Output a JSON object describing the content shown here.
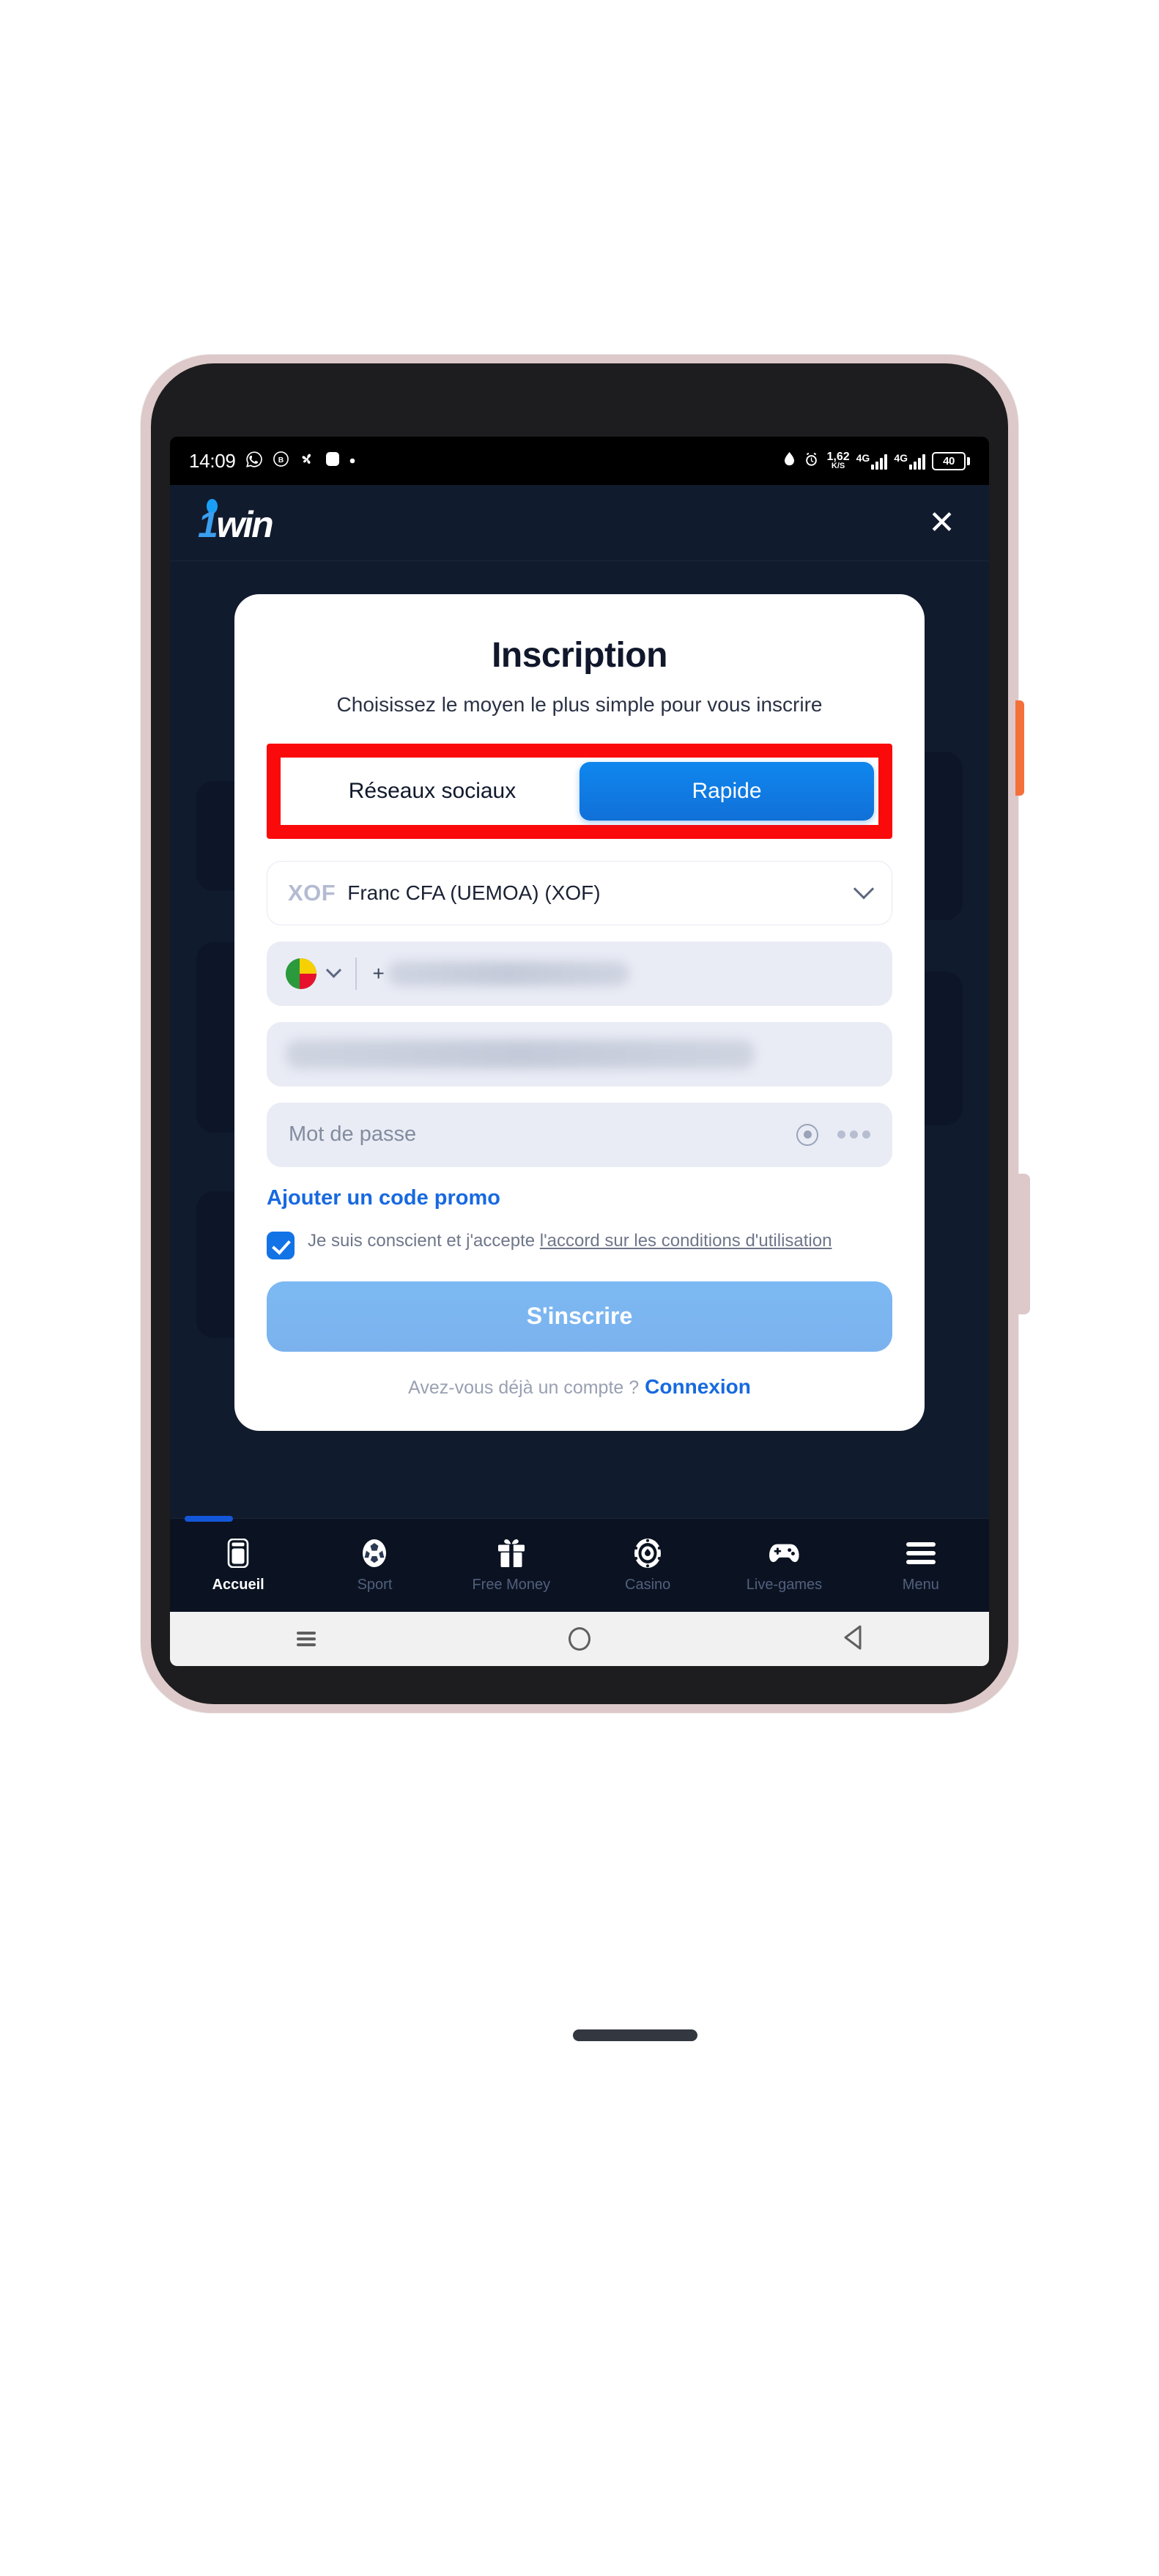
{
  "status_bar": {
    "time": "14:09",
    "left_icons": [
      "whatsapp-icon",
      "b-circle-icon",
      "fan-icon",
      "rounded-square-icon",
      "dot-icon"
    ],
    "network_speed_value": "1,62",
    "network_speed_unit": "K/S",
    "sim1_network": "4G",
    "sim2_network": "4G",
    "battery_level": "40",
    "right_icons": [
      "water-drop-icon",
      "alarm-icon"
    ]
  },
  "app_header": {
    "brand_one": "1",
    "brand_win": "win",
    "close_label": "✕"
  },
  "modal": {
    "title": "Inscription",
    "subtitle": "Choisissez le moyen le plus simple pour vous inscrire",
    "tabs": [
      {
        "label": "Réseaux sociaux",
        "active": false
      },
      {
        "label": "Rapide",
        "active": true
      }
    ],
    "currency": {
      "code": "XOF",
      "name": "Franc CFA (UEMOA) (XOF)"
    },
    "phone": {
      "country_flag": "benin-flag-icon",
      "prefix": "+",
      "value": ""
    },
    "email": {
      "value": ""
    },
    "password": {
      "placeholder": "Mot de passe",
      "value": ""
    },
    "promo_link": "Ajouter un code promo",
    "terms": {
      "text_lead": "Je suis conscient et j'accepte ",
      "link_text": "l'accord sur les conditions d'utilisation",
      "checked": true
    },
    "submit_label": "S'inscrire",
    "login_prompt": "Avez-vous déjà un compte ?",
    "login_link": "Connexion"
  },
  "bottom_nav": [
    {
      "label": "Accueil",
      "icon": "home-phone-icon",
      "active": true
    },
    {
      "label": "Sport",
      "icon": "soccer-ball-icon",
      "active": false
    },
    {
      "label": "Free Money",
      "icon": "gift-icon",
      "active": false
    },
    {
      "label": "Casino",
      "icon": "casino-chip-icon",
      "active": false
    },
    {
      "label": "Live-games",
      "icon": "gamepad-icon",
      "active": false
    },
    {
      "label": "Menu",
      "icon": "hamburger-icon",
      "active": false
    }
  ],
  "android_nav": [
    {
      "icon": "recents-icon"
    },
    {
      "icon": "home-circle-icon"
    },
    {
      "icon": "back-triangle-icon"
    }
  ],
  "colors": {
    "brand_blue": "#1a9ef5",
    "accent_blue": "#1070d8",
    "highlight_red": "#fa0a0a",
    "app_bg": "#111b2e",
    "power_button_orange": "#f4703a"
  }
}
